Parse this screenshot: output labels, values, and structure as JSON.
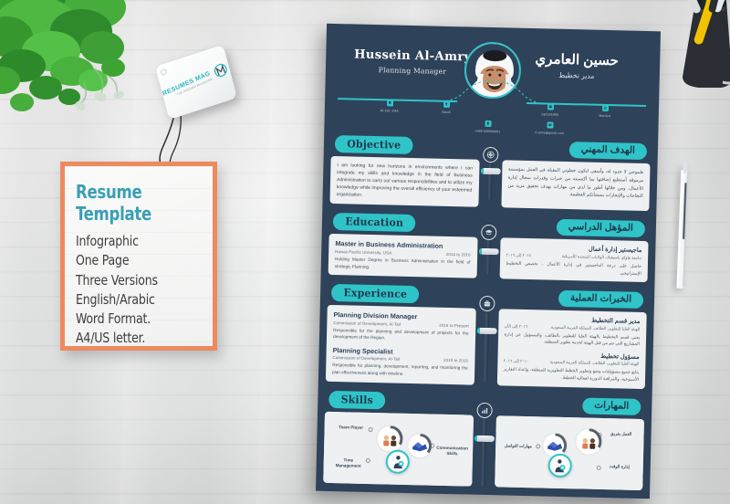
{
  "scene": {
    "background": "white wooden desk",
    "objects": [
      "potted-plant",
      "pen-cup",
      "silver-pen",
      "hang-tag",
      "info-card",
      "resume-sheet"
    ]
  },
  "colors": {
    "teal": "#2fc4c8",
    "navy": "#2e4259",
    "orange": "#ed8a5f",
    "title_blue": "#3a9fb5",
    "card_bg": "#eef0f1"
  },
  "tag": {
    "brand_main": "RESUMES MAG",
    "brand_sub": "THE RESUME MAGAZINE",
    "monogram": "RM"
  },
  "info_card": {
    "title": "Resume Template",
    "features": [
      "Infographic",
      "One Page",
      "Three Versions",
      "English/Arabic",
      "Word Format.",
      "A4/US letter."
    ]
  },
  "resume": {
    "name_en": "Hussein  Al-Amry",
    "role_en": "Planning Manager",
    "name_ar": "حسين العامري",
    "role_ar": "مدير تخطيط",
    "photo_alt": "portrait-photo",
    "contacts": [
      {
        "icon": "location-icon",
        "value": "Al-Taif, KSA"
      },
      {
        "icon": "gender-icon",
        "value": "Saudi"
      },
      {
        "icon": "phone-icon",
        "value": "+966-500000001"
      },
      {
        "icon": "email-icon",
        "value": "h.amry@gmail.com"
      },
      {
        "icon": "calendar-icon",
        "value": "06/10/1980"
      },
      {
        "icon": "ring-icon",
        "value": "Married"
      }
    ],
    "sections": [
      {
        "id": "objective",
        "title_en": "Objective",
        "title_ar": "الهدف المهني",
        "icon": "target-icon",
        "body_en": "I am looking for new horizons in environments where I can integrate my skills and knowledge in the field of Business Administration to carry out various responsibilities and to utilize my knowledge while improving the overall efficiency of your esteemed organization.",
        "body_ar": "طموحي لا حدود له، وأسعى لتكون خطوتي المقبلة في العمل بمؤسسة مرموقة أستطيع إضافتها بما أكتسبته من خبرات وقدرات بمجال إدارة الأعمال، ومن خلالها أطور ما لدي من مهارات بهدف تحقيق مزيد من النجاحات والإنجازات بمنشأتكم العظيمة."
      },
      {
        "id": "education",
        "title_en": "Education",
        "title_ar": "المؤهل الدراسي",
        "icon": "graduation-cap-icon",
        "entries_en": [
          {
            "title": "Master in Business Administration",
            "org": "Hawaii Pacific University, USA.",
            "period": "2014 to 2016",
            "desc": "Holding Master Degree in Business Administration in the field of strategic Planning."
          }
        ],
        "entries_ar": [
          {
            "title": "ماجيستير إدارة أعمال",
            "org": "جامعة هاواي باسيفيك، الولايات المتحدة الأمريكية",
            "period": "٢٠١٤ إلى ٢٠١٦",
            "desc": "حاصل على درجة الماجستير في إدارة الأعمال - تخصص التخطيط الإستراتيجي."
          }
        ]
      },
      {
        "id": "experience",
        "title_en": "Experience",
        "title_ar": "الخبرات العملية",
        "icon": "briefcase-icon",
        "entries_en": [
          {
            "title": "Planning Division Manager",
            "org": "Commission of Development, Al-Taif",
            "period": "2016 to Present",
            "desc": "Responsible for the planning and development of projects for the development of the Region."
          },
          {
            "title": "Planning Specialist",
            "org": "Commission of Development, Al-Taif",
            "period": "2010 to 2016",
            "desc": "Responsible for planning, development, reporting, and monitoring the plan effectiveness along with timeline."
          }
        ],
        "entries_ar": [
          {
            "title": "مدير قسم التخطيط",
            "org": "الهيئة العليا للتطوير، الطائف، المملكة العربية السعودية",
            "period": "٢٠١٦ إلى الآن",
            "desc": "يعني قسم التخطيط بالهيئة العليا للتطوير بالطائف، والمسؤول عن إدارة المشاريع التي تتم من قبل الهيئة لخدمة تطوير المنطقة."
          },
          {
            "title": "مسؤول تخطيط",
            "org": "الهيئة العليا للتطوير، الطائف، المملكة العربية السعودية",
            "period": "٢٠١٠ إلى ٢٠١٦",
            "desc": "يتابع جميع مسؤوليات وضع وتطوير الخطط التطويرية للمنطقة، وإعداد التقارير الأسبوعية، والمراقبة الدورية لفعالية الخطط."
          }
        ]
      },
      {
        "id": "skills",
        "title_en": "Skills",
        "title_ar": "المهارات",
        "icon": "chart-bars-icon",
        "skills_en": [
          "Team Player",
          "Time Management",
          "Communication Skills"
        ],
        "skills_ar": [
          "العمل بفريق",
          "مهارات التواصل",
          "إدارة الوقت"
        ]
      }
    ]
  }
}
